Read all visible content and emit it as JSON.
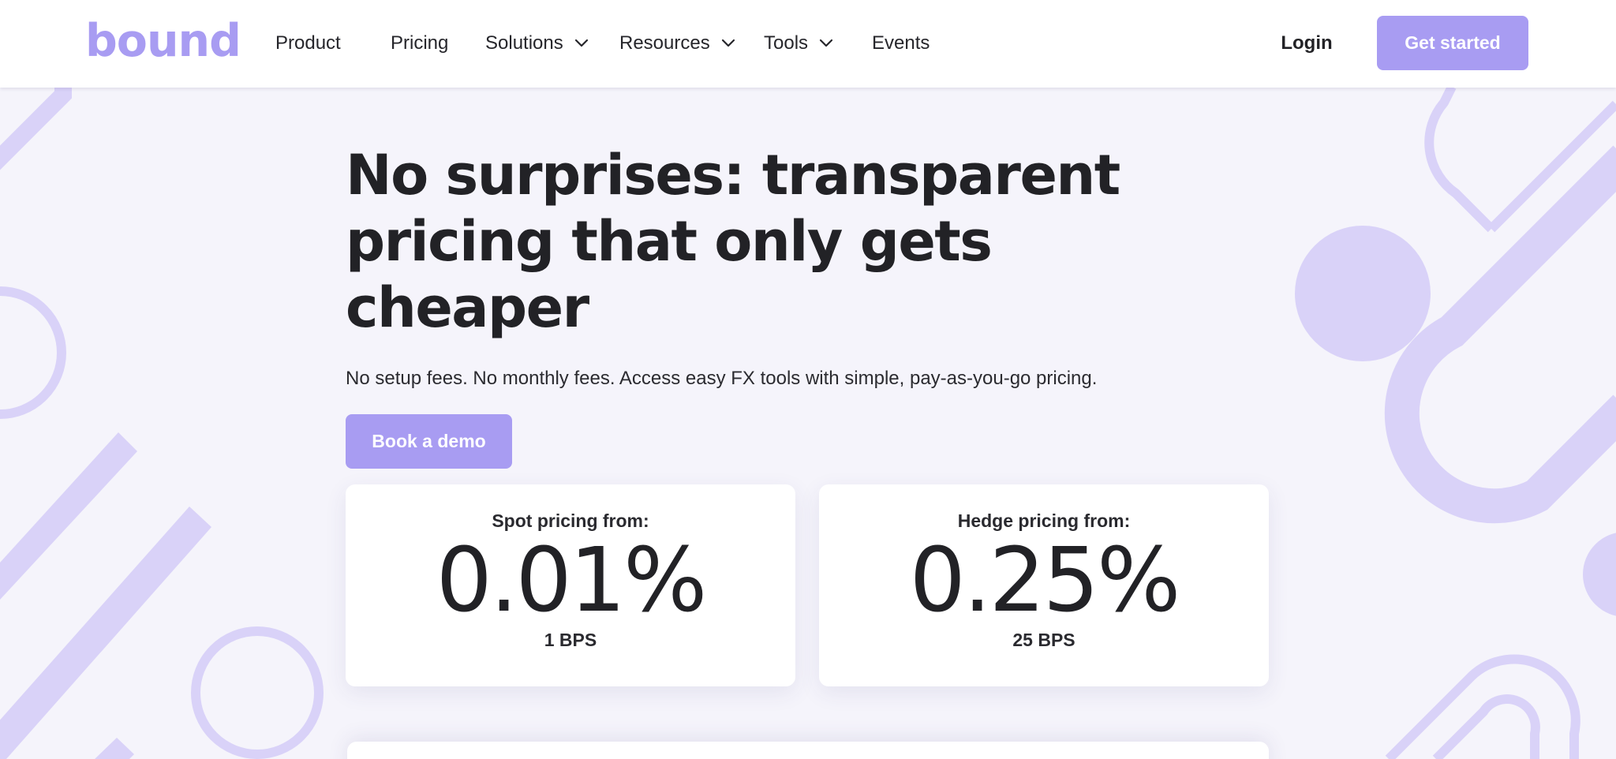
{
  "header": {
    "logo_text": "bound",
    "nav": [
      {
        "label": "Product",
        "has_dropdown": false
      },
      {
        "label": "Pricing",
        "has_dropdown": false
      },
      {
        "label": "Solutions",
        "has_dropdown": true
      },
      {
        "label": "Resources",
        "has_dropdown": true
      },
      {
        "label": "Tools",
        "has_dropdown": true
      },
      {
        "label": "Events",
        "has_dropdown": false
      }
    ],
    "login_label": "Login",
    "cta_label": "Get started"
  },
  "hero": {
    "title_line1": "No surprises: transparent",
    "title_line2": "pricing that only gets cheaper",
    "subtitle": "No setup fees. No monthly fees. Access easy FX tools with simple, pay-as-you-go pricing.",
    "demo_label": "Book a demo"
  },
  "pricing": [
    {
      "label": "Spot pricing from:",
      "value": "0.01%",
      "bps": "1 BPS"
    },
    {
      "label": "Hedge pricing from:",
      "value": "0.25%",
      "bps": "25 BPS"
    }
  ],
  "colors": {
    "accent": "#a89cf2",
    "decor": "#d9d2f8",
    "background": "#f5f4fb",
    "text": "#222226"
  }
}
